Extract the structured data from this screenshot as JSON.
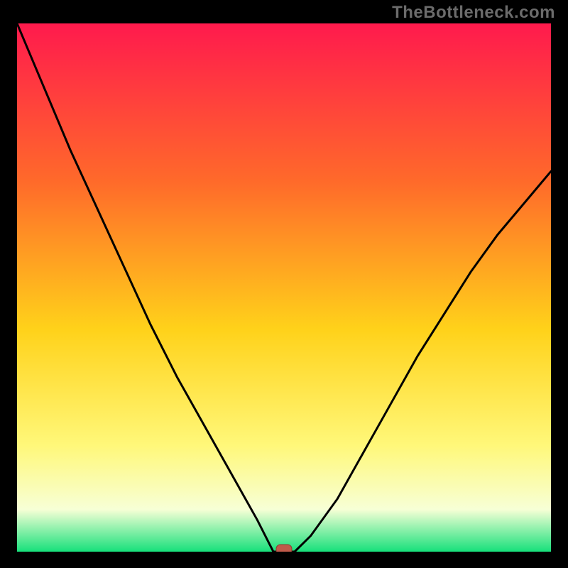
{
  "watermark": "TheBottleneck.com",
  "colors": {
    "frame": "#000000",
    "watermark_text": "#6b6b6b",
    "curve": "#000000",
    "marker_fill": "#c05a4a",
    "marker_stroke": "#8a3c30",
    "gradient_top": "#ff1a4d",
    "gradient_mid_upper": "#ff6a2a",
    "gradient_mid": "#ffd21a",
    "gradient_mid_lower": "#fff87a",
    "gradient_pale": "#f7ffd6",
    "gradient_bottom": "#17e07b"
  },
  "chart_data": {
    "type": "line",
    "title": "",
    "xlabel": "",
    "ylabel": "",
    "xlim": [
      0,
      100
    ],
    "ylim": [
      0,
      100
    ],
    "grid": false,
    "legend": false,
    "series": [
      {
        "name": "curve",
        "x": [
          0,
          5,
          10,
          15,
          20,
          25,
          30,
          35,
          40,
          45,
          47,
          48,
          50,
          52,
          55,
          60,
          65,
          70,
          75,
          80,
          85,
          90,
          95,
          100
        ],
        "y": [
          100,
          88,
          76,
          65,
          54,
          43,
          33,
          24,
          15,
          6,
          2,
          0,
          0,
          0,
          3,
          10,
          19,
          28,
          37,
          45,
          53,
          60,
          66,
          72
        ]
      }
    ],
    "marker": {
      "x": 50,
      "y": 0
    },
    "background_gradient_stops": [
      {
        "pos": 0.0,
        "color": "#ff1a4d"
      },
      {
        "pos": 0.3,
        "color": "#ff6a2a"
      },
      {
        "pos": 0.58,
        "color": "#ffd21a"
      },
      {
        "pos": 0.8,
        "color": "#fff87a"
      },
      {
        "pos": 0.92,
        "color": "#f7ffd6"
      },
      {
        "pos": 1.0,
        "color": "#17e07b"
      }
    ]
  }
}
